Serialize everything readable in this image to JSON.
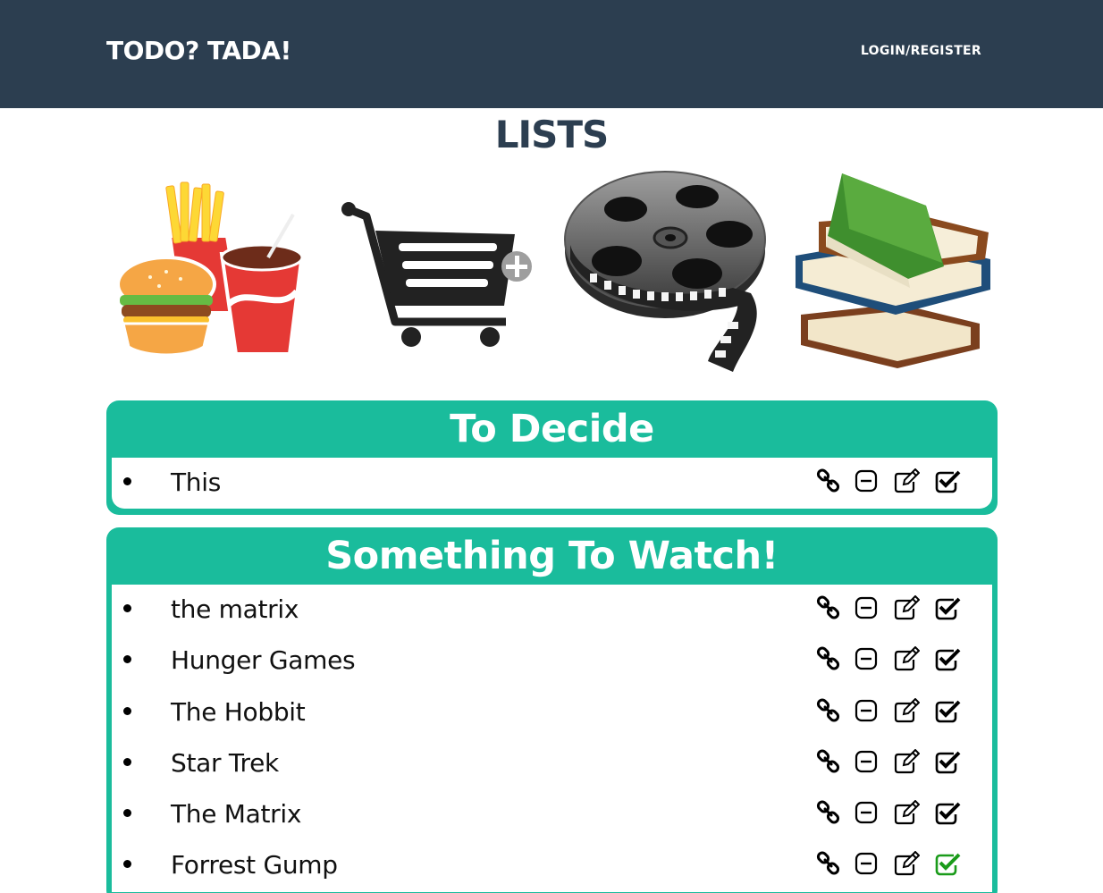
{
  "header": {
    "brand": "TODO? TADA!",
    "login_label": "LOGIN/REGISTER"
  },
  "page_title": "LISTS",
  "categories": [
    {
      "icon": "food-icon"
    },
    {
      "icon": "shopping-cart-icon"
    },
    {
      "icon": "film-reel-icon"
    },
    {
      "icon": "books-icon"
    }
  ],
  "lists": [
    {
      "title": "To Decide",
      "items": [
        {
          "text": "This",
          "completed": false
        }
      ]
    },
    {
      "title": "Something To Watch!",
      "items": [
        {
          "text": "the matrix",
          "completed": false
        },
        {
          "text": "Hunger Games",
          "completed": false
        },
        {
          "text": "The Hobbit",
          "completed": false
        },
        {
          "text": "Star Trek",
          "completed": false
        },
        {
          "text": "The Matrix",
          "completed": false
        },
        {
          "text": "Forrest Gump",
          "completed": true
        }
      ]
    }
  ],
  "item_actions": [
    "link-icon",
    "minus-square-icon",
    "edit-icon",
    "check-square-icon"
  ],
  "colors": {
    "navbar": "#2c3e50",
    "accent": "#1abc9c",
    "completed_check": "#1a9b1a",
    "title": "#2c3e50"
  }
}
